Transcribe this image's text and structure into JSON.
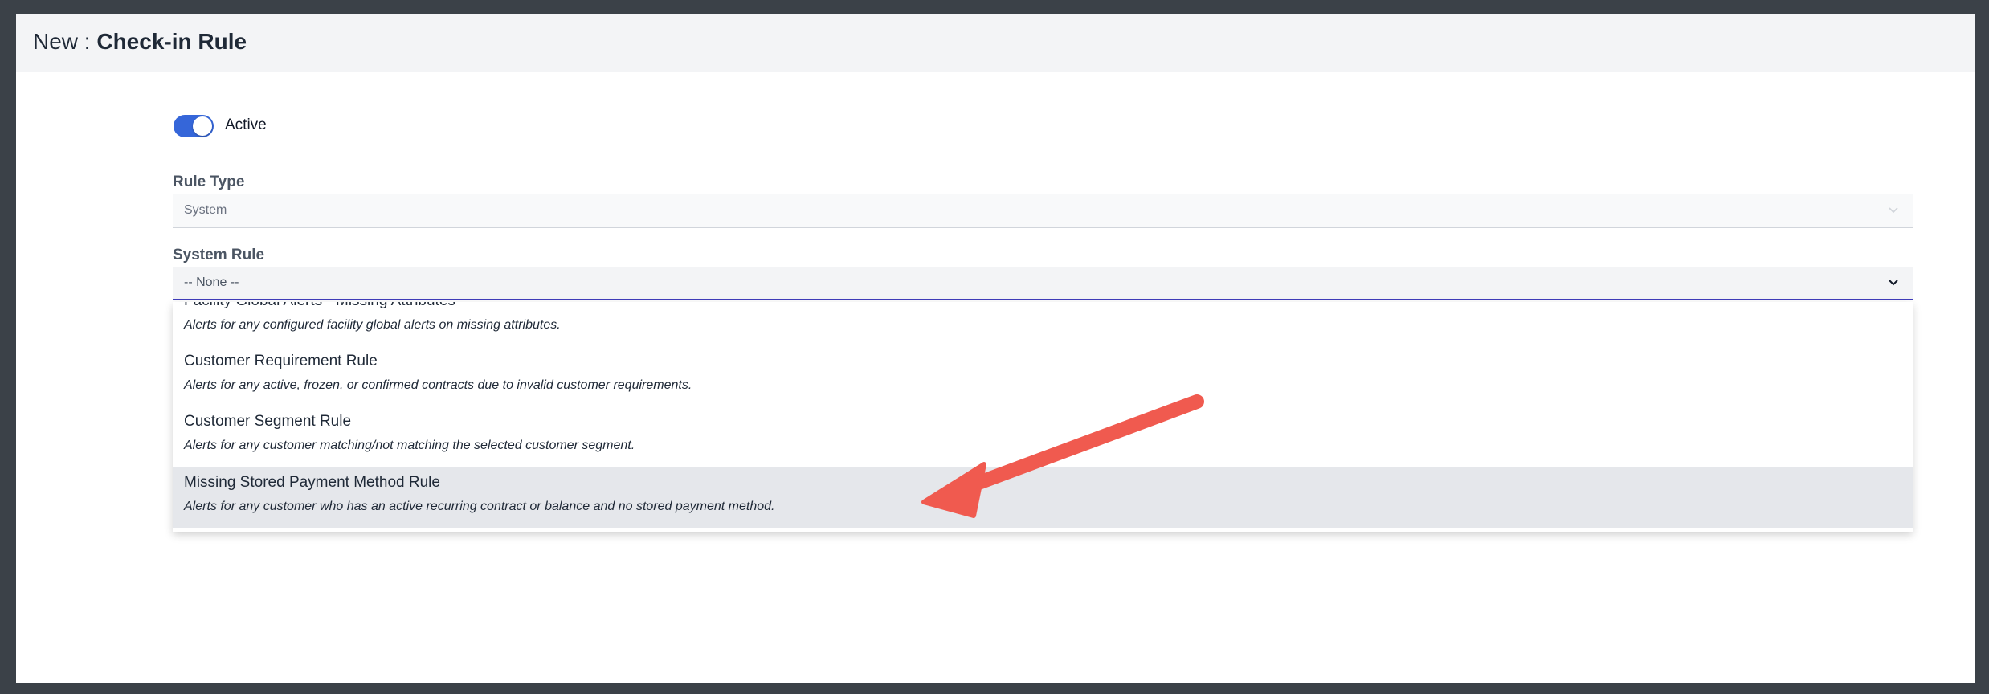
{
  "header": {
    "prefix": "New : ",
    "title": "Check-in Rule"
  },
  "active_toggle": {
    "label": "Active",
    "on": true
  },
  "rule_type": {
    "label": "Rule Type",
    "value": "System"
  },
  "system_rule": {
    "label": "System Rule",
    "value": "-- None --"
  },
  "options": [
    {
      "label": "Facility Global Alerts - Missing Attributes",
      "description": "Alerts for any configured facility global alerts on missing attributes."
    },
    {
      "label": "Customer Requirement Rule",
      "description": "Alerts for any active, frozen, or confirmed contracts due to invalid customer requirements."
    },
    {
      "label": "Customer Segment Rule",
      "description": "Alerts for any customer matching/not matching the selected customer segment."
    },
    {
      "label": "Missing Stored Payment Method Rule",
      "description": "Alerts for any customer who has an active recurring contract or balance and no stored payment method."
    }
  ],
  "highlighted_option_index": 3,
  "colors": {
    "accent": "#3566d9",
    "focus_border": "#3f3cbb",
    "annotation_arrow": "#f05a4f",
    "highlight_bg": "#e5e7eb"
  }
}
